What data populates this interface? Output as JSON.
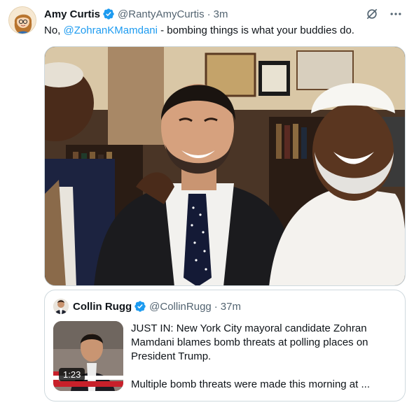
{
  "tweet": {
    "author_name": "Amy Curtis",
    "author_handle": "@RantyAmyCurtis",
    "separator": "·",
    "time": "3m",
    "text_prefix": "No, ",
    "mention": "@ZohranKMamdani",
    "text_suffix": " - bombing things is what your buddies do.",
    "icons": [
      "verified-badge-icon",
      "grok-icon",
      "more-icon"
    ]
  },
  "quote": {
    "author_name": "Collin Rugg",
    "author_handle": "@CollinRugg",
    "separator": "·",
    "time": "37m",
    "paragraph_1": "JUST IN: New York City mayoral candidate Zohran Mamdani blames bomb threats at polling places on President Trump.",
    "paragraph_2": "Multiple bomb threats were made this morning at ...",
    "video_duration": "1:23"
  },
  "colors": {
    "text": "#0f1419",
    "secondary": "#536471",
    "link": "#1d9bf0",
    "border": "#cfd9de"
  }
}
